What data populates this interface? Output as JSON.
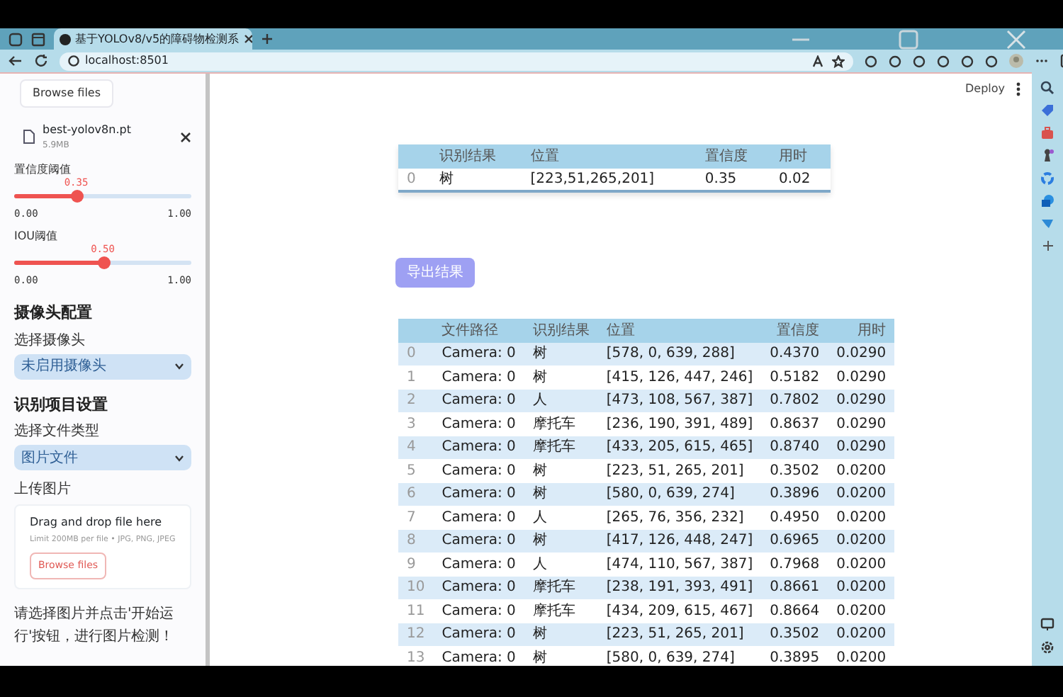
{
  "browser": {
    "tab_title": "基于YOLOv8/v5的障碍物检测系",
    "url": "localhost:8501"
  },
  "app": {
    "deploy": "Deploy",
    "sidebar": {
      "top_button": "Browse files",
      "file": {
        "name": "best-yolov8n.pt",
        "size": "5.9MB"
      },
      "sliders": [
        {
          "label": "置信度阈值",
          "value": "0.35",
          "level": 0.35,
          "min": "0.00",
          "max": "1.00"
        },
        {
          "label": "IOU阈值",
          "value": "0.50",
          "level": 0.5,
          "min": "0.00",
          "max": "1.00"
        }
      ],
      "sections": [
        {
          "title": "摄像头配置",
          "select_label": "选择摄像头",
          "select_value": "未启用摄像头"
        },
        {
          "title": "识别项目设置",
          "select_label": "选择文件类型",
          "select_value": "图片文件"
        }
      ],
      "upload": {
        "label": "上传图片",
        "drop_text": "Drag and drop file here",
        "limit": "Limit 200MB per file • JPG, PNG, JPEG",
        "button": "Browse files"
      },
      "message": "请选择图片并点击'开始运行'按钮，进行图片检测！"
    },
    "result_table": {
      "columns": [
        "",
        "识别结果",
        "位置",
        "置信度",
        "用时"
      ],
      "rows": [
        [
          "0",
          "树",
          "[223,51,265,201]",
          "0.35",
          "0.02"
        ]
      ]
    },
    "export_button": "导出结果",
    "log_table": {
      "columns": [
        "",
        "文件路径",
        "识别结果",
        "位置",
        "置信度",
        "用时"
      ],
      "rows": [
        [
          "0",
          "Camera: 0",
          "树",
          "[578, 0, 639, 288]",
          "0.4370",
          "0.0290"
        ],
        [
          "1",
          "Camera: 0",
          "树",
          "[415, 126, 447, 246]",
          "0.5182",
          "0.0290"
        ],
        [
          "2",
          "Camera: 0",
          "人",
          "[473, 108, 567, 387]",
          "0.7802",
          "0.0290"
        ],
        [
          "3",
          "Camera: 0",
          "摩托车",
          "[236, 190, 391, 489]",
          "0.8637",
          "0.0290"
        ],
        [
          "4",
          "Camera: 0",
          "摩托车",
          "[433, 205, 615, 465]",
          "0.8740",
          "0.0290"
        ],
        [
          "5",
          "Camera: 0",
          "树",
          "[223, 51, 265, 201]",
          "0.3502",
          "0.0200"
        ],
        [
          "6",
          "Camera: 0",
          "树",
          "[580, 0, 639, 274]",
          "0.3896",
          "0.0200"
        ],
        [
          "7",
          "Camera: 0",
          "人",
          "[265, 76, 356, 232]",
          "0.4950",
          "0.0200"
        ],
        [
          "8",
          "Camera: 0",
          "树",
          "[417, 126, 448, 247]",
          "0.6965",
          "0.0200"
        ],
        [
          "9",
          "Camera: 0",
          "人",
          "[474, 110, 567, 387]",
          "0.7968",
          "0.0200"
        ],
        [
          "10",
          "Camera: 0",
          "摩托车",
          "[238, 191, 393, 491]",
          "0.8661",
          "0.0200"
        ],
        [
          "11",
          "Camera: 0",
          "摩托车",
          "[434, 209, 615, 467]",
          "0.8664",
          "0.0200"
        ],
        [
          "12",
          "Camera: 0",
          "树",
          "[223, 51, 265, 201]",
          "0.3502",
          "0.0200"
        ],
        [
          "13",
          "Camera: 0",
          "树",
          "[580, 0, 639, 274]",
          "0.3895",
          "0.0200"
        ]
      ]
    }
  }
}
